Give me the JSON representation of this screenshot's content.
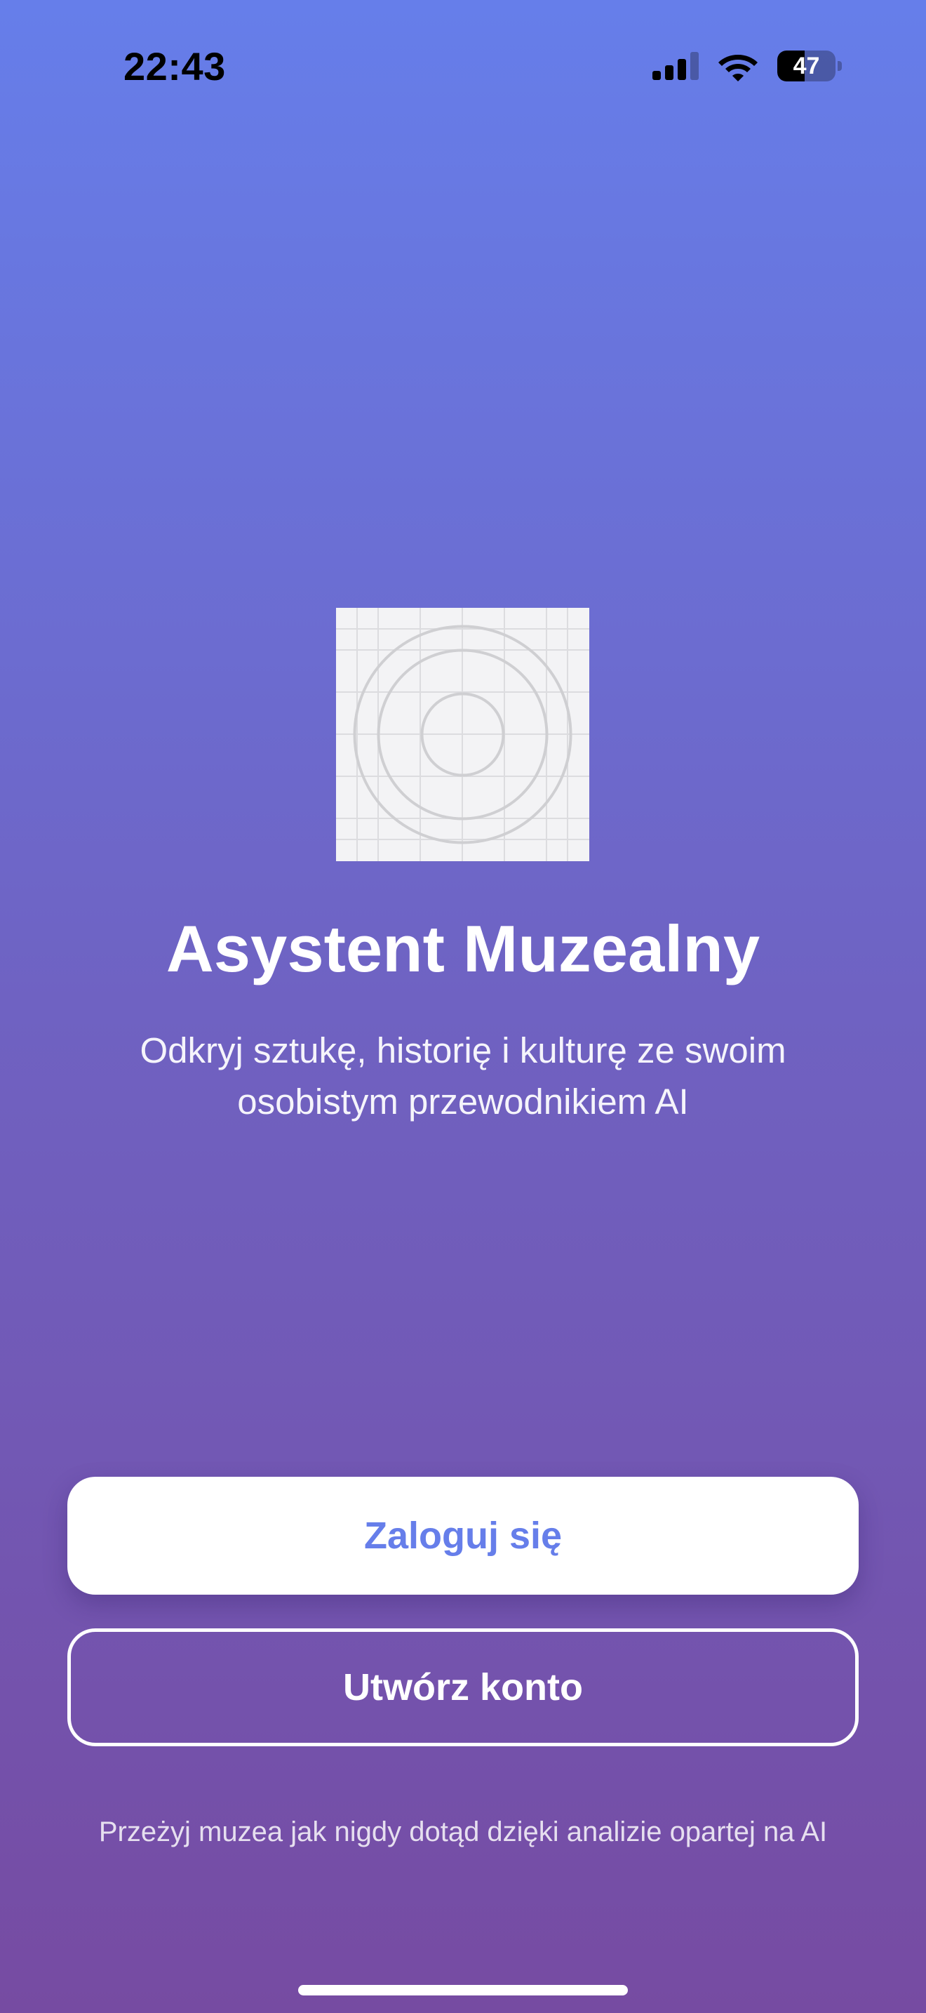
{
  "status_bar": {
    "time": "22:43",
    "battery_level": "47",
    "battery_fraction": 0.47,
    "icons": [
      "signal-icon",
      "wifi-icon",
      "battery-icon"
    ]
  },
  "hero": {
    "image": "placeholder-image-icon"
  },
  "app": {
    "title": "Asystent Muzealny",
    "subtitle": "Odkryj sztukę, historię i kulturę ze swoim osobistym przewodnikiem AI"
  },
  "actions": {
    "login_label": "Zaloguj się",
    "signup_label": "Utwórz konto"
  },
  "footer": {
    "tagline": "Przeżyj muzea jak nigdy dotąd dzięki analizie opartej na AI"
  },
  "colors": {
    "gradient_top": "#667eea",
    "gradient_bottom": "#764ba2",
    "accent": "#667eea",
    "button_bg": "#ffffff"
  }
}
